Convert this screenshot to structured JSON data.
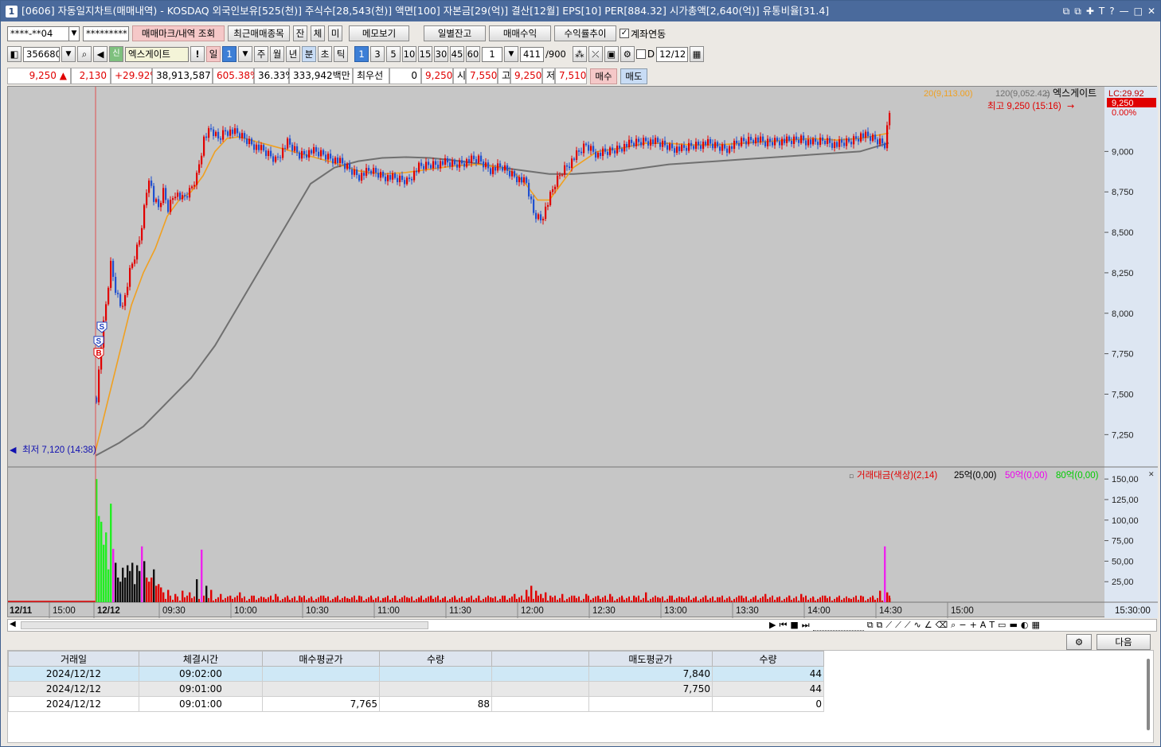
{
  "title": {
    "badge": "1",
    "text": "[0606] 자동일지차트(매매내역) - KOSDAQ 외국인보유[525(천)] 주식수[28,543(천)] 액면[100] 자본금[29(억)] 결산[12월] EPS[10] PER[884.32] 시가총액[2,640(억)] 유통비율[31.4]",
    "window_buttons": [
      "⧉",
      "⧉",
      "✚",
      "T",
      "?",
      "—",
      "□",
      "✕"
    ]
  },
  "toolbar1": {
    "account": "****-**04",
    "password": "*********",
    "buttons": [
      "매매마크/내역 조회",
      "최근매매종목",
      "잔",
      "체",
      "미",
      "메모보기",
      "일별잔고",
      "매매수익",
      "수익률추이"
    ],
    "link_label": "계좌연동"
  },
  "toolbar2": {
    "code": "356680",
    "stock_name": "엑스게이트",
    "period_buttons": [
      "일",
      "1",
      "주",
      "월",
      "년",
      "분",
      "초",
      "틱"
    ],
    "minute_buttons": [
      "1",
      "3",
      "5",
      "10",
      "15",
      "30",
      "45",
      "60"
    ],
    "multiplier": "1",
    "count": "411",
    "count_total": "/900",
    "date": "12/12",
    "d_label": "D"
  },
  "quote": {
    "price": "9,250",
    "change": "2,130",
    "change_pct": "+29.92%",
    "volume": "38,913,587",
    "volume_pct": "605.38%",
    "turnover_pct": "36.33%",
    "amount": "333,942백만",
    "priority_label": "최우선",
    "priority_qty": "0",
    "priority_price": "9,250",
    "open_label": "시",
    "open": "7,550",
    "high_label": "고",
    "high": "9,250",
    "low_label": "저",
    "low": "7,510",
    "buy_label": "매수",
    "sell_label": "매도"
  },
  "chart_data": {
    "type": "line",
    "price_legend": {
      "ma20": "20(9,113.00)",
      "ma120": "120(9,052.42)",
      "name": "엑스게이트",
      "lc": "LC:29.92",
      "last_price_tag": "9,250",
      "last_pct_tag": "0.00%",
      "high_annotation": "최고 9,250 (15:16)",
      "low_annotation": "최저 7,120 (14:38)"
    },
    "price_ticks": [
      "9,000",
      "8,750",
      "8,500",
      "8,250",
      "8,000",
      "7,750",
      "7,500",
      "7,250"
    ],
    "price_tick_values": [
      9000,
      8750,
      8500,
      8250,
      8000,
      7750,
      7500,
      7250
    ],
    "ylim": [
      7050,
      9400
    ],
    "volume_legend": {
      "name": "거래대금(색상)(2,14)",
      "l25": "25억(0,00)",
      "l50": "50억(0,00)",
      "l80": "80억(0,00)"
    },
    "volume_ticks": [
      "150,00",
      "125,00",
      "100,00",
      "75,00",
      "50,00",
      "25,00"
    ],
    "volume_tick_values": [
      150,
      125,
      100,
      75,
      50,
      25
    ],
    "volume_ylim": [
      0,
      155
    ],
    "x_labels": [
      "12/11",
      "15:00",
      "12/12",
      "09:30",
      "10:00",
      "10:30",
      "11:00",
      "11:30",
      "12:00",
      "12:30",
      "13:00",
      "13:30",
      "14:00",
      "14:30",
      "15:00",
      "15:30:00"
    ],
    "x_tick_minutes": [
      0,
      30,
      60,
      90,
      120,
      150,
      180,
      210,
      240,
      270,
      300,
      330,
      360,
      390
    ],
    "price_path": [
      [
        0,
        7480
      ],
      [
        2,
        7800
      ],
      [
        4,
        8050
      ],
      [
        6,
        8300
      ],
      [
        8,
        8150
      ],
      [
        10,
        8050
      ],
      [
        12,
        8100
      ],
      [
        14,
        8250
      ],
      [
        16,
        8350
      ],
      [
        18,
        8450
      ],
      [
        20,
        8650
      ],
      [
        22,
        8850
      ],
      [
        24,
        8700
      ],
      [
        26,
        8650
      ],
      [
        28,
        8750
      ],
      [
        30,
        8650
      ],
      [
        33,
        8750
      ],
      [
        36,
        8700
      ],
      [
        39,
        8750
      ],
      [
        42,
        8850
      ],
      [
        45,
        9080
      ],
      [
        48,
        9130
      ],
      [
        51,
        9080
      ],
      [
        54,
        9130
      ],
      [
        57,
        9120
      ],
      [
        60,
        9100
      ],
      [
        65,
        9050
      ],
      [
        70,
        9000
      ],
      [
        75,
        8950
      ],
      [
        80,
        9050
      ],
      [
        85,
        8980
      ],
      [
        90,
        9000
      ],
      [
        95,
        8980
      ],
      [
        100,
        8950
      ],
      [
        105,
        8900
      ],
      [
        110,
        8850
      ],
      [
        115,
        8880
      ],
      [
        120,
        8850
      ],
      [
        125,
        8830
      ],
      [
        130,
        8820
      ],
      [
        135,
        8900
      ],
      [
        140,
        8920
      ],
      [
        145,
        8930
      ],
      [
        150,
        8920
      ],
      [
        155,
        8940
      ],
      [
        160,
        8950
      ],
      [
        165,
        8890
      ],
      [
        170,
        8900
      ],
      [
        175,
        8850
      ],
      [
        180,
        8800
      ],
      [
        183,
        8620
      ],
      [
        186,
        8580
      ],
      [
        189,
        8680
      ],
      [
        192,
        8800
      ],
      [
        195,
        8880
      ],
      [
        200,
        8960
      ],
      [
        205,
        9040
      ],
      [
        210,
        8980
      ],
      [
        215,
        9000
      ],
      [
        220,
        9030
      ],
      [
        225,
        9050
      ],
      [
        230,
        9070
      ],
      [
        235,
        9050
      ],
      [
        240,
        9030
      ],
      [
        245,
        9010
      ],
      [
        250,
        9040
      ],
      [
        255,
        9050
      ],
      [
        260,
        9030
      ],
      [
        265,
        9020
      ],
      [
        270,
        9060
      ],
      [
        275,
        9080
      ],
      [
        280,
        9050
      ],
      [
        285,
        9070
      ],
      [
        290,
        9060
      ],
      [
        295,
        9080
      ],
      [
        300,
        9050
      ],
      [
        305,
        9070
      ],
      [
        310,
        9040
      ],
      [
        315,
        9060
      ],
      [
        320,
        9100
      ],
      [
        325,
        9080
      ],
      [
        330,
        9050
      ],
      [
        332,
        9250
      ]
    ],
    "ma20_path": [
      [
        0,
        7150
      ],
      [
        5,
        7450
      ],
      [
        10,
        7750
      ],
      [
        15,
        8050
      ],
      [
        20,
        8250
      ],
      [
        25,
        8400
      ],
      [
        30,
        8600
      ],
      [
        35,
        8700
      ],
      [
        40,
        8750
      ],
      [
        45,
        8850
      ],
      [
        50,
        9000
      ],
      [
        55,
        9080
      ],
      [
        60,
        9090
      ],
      [
        70,
        9050
      ],
      [
        80,
        9010
      ],
      [
        90,
        8970
      ],
      [
        100,
        8930
      ],
      [
        110,
        8880
      ],
      [
        120,
        8860
      ],
      [
        130,
        8870
      ],
      [
        140,
        8890
      ],
      [
        150,
        8910
      ],
      [
        160,
        8920
      ],
      [
        170,
        8900
      ],
      [
        175,
        8870
      ],
      [
        180,
        8800
      ],
      [
        185,
        8700
      ],
      [
        190,
        8700
      ],
      [
        195,
        8800
      ],
      [
        200,
        8900
      ],
      [
        210,
        9000
      ],
      [
        220,
        9020
      ],
      [
        230,
        9050
      ],
      [
        240,
        9050
      ],
      [
        250,
        9040
      ],
      [
        260,
        9040
      ],
      [
        270,
        9050
      ],
      [
        280,
        9060
      ],
      [
        290,
        9070
      ],
      [
        300,
        9080
      ],
      [
        310,
        9070
      ],
      [
        320,
        9080
      ],
      [
        332,
        9113
      ]
    ],
    "ma120_path": [
      [
        0,
        7120
      ],
      [
        10,
        7200
      ],
      [
        20,
        7300
      ],
      [
        30,
        7450
      ],
      [
        40,
        7600
      ],
      [
        50,
        7800
      ],
      [
        60,
        8050
      ],
      [
        70,
        8300
      ],
      [
        80,
        8550
      ],
      [
        90,
        8800
      ],
      [
        100,
        8900
      ],
      [
        110,
        8940
      ],
      [
        120,
        8960
      ],
      [
        130,
        8965
      ],
      [
        140,
        8960
      ],
      [
        150,
        8945
      ],
      [
        160,
        8925
      ],
      [
        170,
        8900
      ],
      [
        180,
        8880
      ],
      [
        190,
        8860
      ],
      [
        200,
        8860
      ],
      [
        210,
        8870
      ],
      [
        220,
        8880
      ],
      [
        230,
        8900
      ],
      [
        240,
        8920
      ],
      [
        250,
        8930
      ],
      [
        260,
        8940
      ],
      [
        270,
        8950
      ],
      [
        280,
        8960
      ],
      [
        290,
        8970
      ],
      [
        300,
        8980
      ],
      [
        310,
        8990
      ],
      [
        320,
        9000
      ],
      [
        332,
        9052.42
      ]
    ],
    "volume_bars": [
      [
        0,
        150,
        "green"
      ],
      [
        1,
        105,
        "green"
      ],
      [
        2,
        98,
        "green"
      ],
      [
        3,
        70,
        "green"
      ],
      [
        4,
        85,
        "green"
      ],
      [
        5,
        40,
        "green"
      ],
      [
        6,
        120,
        "green"
      ],
      [
        7,
        65,
        "magenta"
      ],
      [
        8,
        48,
        "black"
      ],
      [
        9,
        30,
        "black"
      ],
      [
        10,
        25,
        "black"
      ],
      [
        11,
        42,
        "black"
      ],
      [
        12,
        30,
        "black"
      ],
      [
        13,
        45,
        "black"
      ],
      [
        14,
        38,
        "black"
      ],
      [
        15,
        48,
        "black"
      ],
      [
        16,
        22,
        "black"
      ],
      [
        17,
        45,
        "black"
      ],
      [
        18,
        38,
        "black"
      ],
      [
        19,
        68,
        "magenta"
      ],
      [
        20,
        50,
        "black"
      ],
      [
        21,
        30,
        "red"
      ],
      [
        22,
        25,
        "red"
      ],
      [
        23,
        30,
        "red"
      ],
      [
        24,
        40,
        "black"
      ],
      [
        25,
        20,
        "red"
      ],
      [
        26,
        22,
        "red"
      ],
      [
        27,
        18,
        "red"
      ],
      [
        28,
        12,
        "red"
      ],
      [
        30,
        15,
        "red"
      ],
      [
        33,
        10,
        "red"
      ],
      [
        36,
        14,
        "red"
      ],
      [
        39,
        12,
        "red"
      ],
      [
        42,
        28,
        "black"
      ],
      [
        44,
        64,
        "magenta"
      ],
      [
        46,
        20,
        "black"
      ],
      [
        48,
        15,
        "red"
      ],
      [
        52,
        10,
        "red"
      ],
      [
        56,
        8,
        "red"
      ],
      [
        60,
        12,
        "red"
      ],
      [
        65,
        8,
        "red"
      ],
      [
        70,
        6,
        "red"
      ],
      [
        75,
        10,
        "red"
      ],
      [
        80,
        6,
        "red"
      ],
      [
        85,
        8,
        "red"
      ],
      [
        90,
        5,
        "red"
      ],
      [
        95,
        8,
        "red"
      ],
      [
        100,
        6,
        "red"
      ],
      [
        105,
        5,
        "red"
      ],
      [
        110,
        8,
        "red"
      ],
      [
        115,
        6,
        "red"
      ],
      [
        120,
        5,
        "red"
      ],
      [
        125,
        8,
        "red"
      ],
      [
        130,
        6,
        "red"
      ],
      [
        135,
        5,
        "red"
      ],
      [
        140,
        8,
        "red"
      ],
      [
        145,
        5,
        "red"
      ],
      [
        150,
        6,
        "red"
      ],
      [
        155,
        5,
        "red"
      ],
      [
        160,
        8,
        "red"
      ],
      [
        165,
        6,
        "red"
      ],
      [
        170,
        8,
        "red"
      ],
      [
        175,
        10,
        "red"
      ],
      [
        180,
        15,
        "red"
      ],
      [
        182,
        20,
        "red"
      ],
      [
        184,
        14,
        "red"
      ],
      [
        186,
        10,
        "red"
      ],
      [
        188,
        12,
        "red"
      ],
      [
        190,
        8,
        "red"
      ],
      [
        195,
        10,
        "red"
      ],
      [
        200,
        8,
        "red"
      ],
      [
        205,
        10,
        "red"
      ],
      [
        210,
        8,
        "red"
      ],
      [
        215,
        10,
        "red"
      ],
      [
        220,
        6,
        "red"
      ],
      [
        225,
        8,
        "red"
      ],
      [
        230,
        12,
        "red"
      ],
      [
        235,
        6,
        "red"
      ],
      [
        240,
        8,
        "red"
      ],
      [
        245,
        6,
        "red"
      ],
      [
        250,
        5,
        "red"
      ],
      [
        255,
        8,
        "red"
      ],
      [
        260,
        6,
        "red"
      ],
      [
        265,
        5,
        "red"
      ],
      [
        270,
        8,
        "red"
      ],
      [
        275,
        6,
        "red"
      ],
      [
        280,
        10,
        "red"
      ],
      [
        285,
        6,
        "red"
      ],
      [
        290,
        8,
        "red"
      ],
      [
        295,
        10,
        "red"
      ],
      [
        300,
        6,
        "red"
      ],
      [
        305,
        8,
        "red"
      ],
      [
        310,
        6,
        "red"
      ],
      [
        315,
        5,
        "red"
      ],
      [
        320,
        8,
        "red"
      ],
      [
        325,
        6,
        "red"
      ],
      [
        328,
        14,
        "red"
      ],
      [
        330,
        68,
        "magenta"
      ],
      [
        331,
        12,
        "red"
      ],
      [
        332,
        5,
        "red"
      ]
    ],
    "trade_markers": [
      "S",
      "S",
      "B"
    ]
  },
  "bottom_toolbar": {
    "next_label": "다음"
  },
  "trades": {
    "headers": [
      "거래일",
      "체결시간",
      "매수평균가",
      "수량",
      "",
      "매도평균가",
      "수량"
    ],
    "rows": [
      [
        "2024/12/12",
        "09:02:00",
        "",
        "",
        "",
        "7,840",
        "44"
      ],
      [
        "2024/12/12",
        "09:01:00",
        "",
        "",
        "",
        "7,750",
        "44"
      ],
      [
        "2024/12/12",
        "09:01:00",
        "7,765",
        "88",
        "",
        "",
        "0"
      ]
    ]
  },
  "colors": {
    "title_bg": "#4a6a9c",
    "chart_bg": "#c6c6c6",
    "candle_up": "#e00000",
    "candle_down": "#2050d0",
    "ma20": "#f0a020",
    "ma120": "#707070"
  }
}
